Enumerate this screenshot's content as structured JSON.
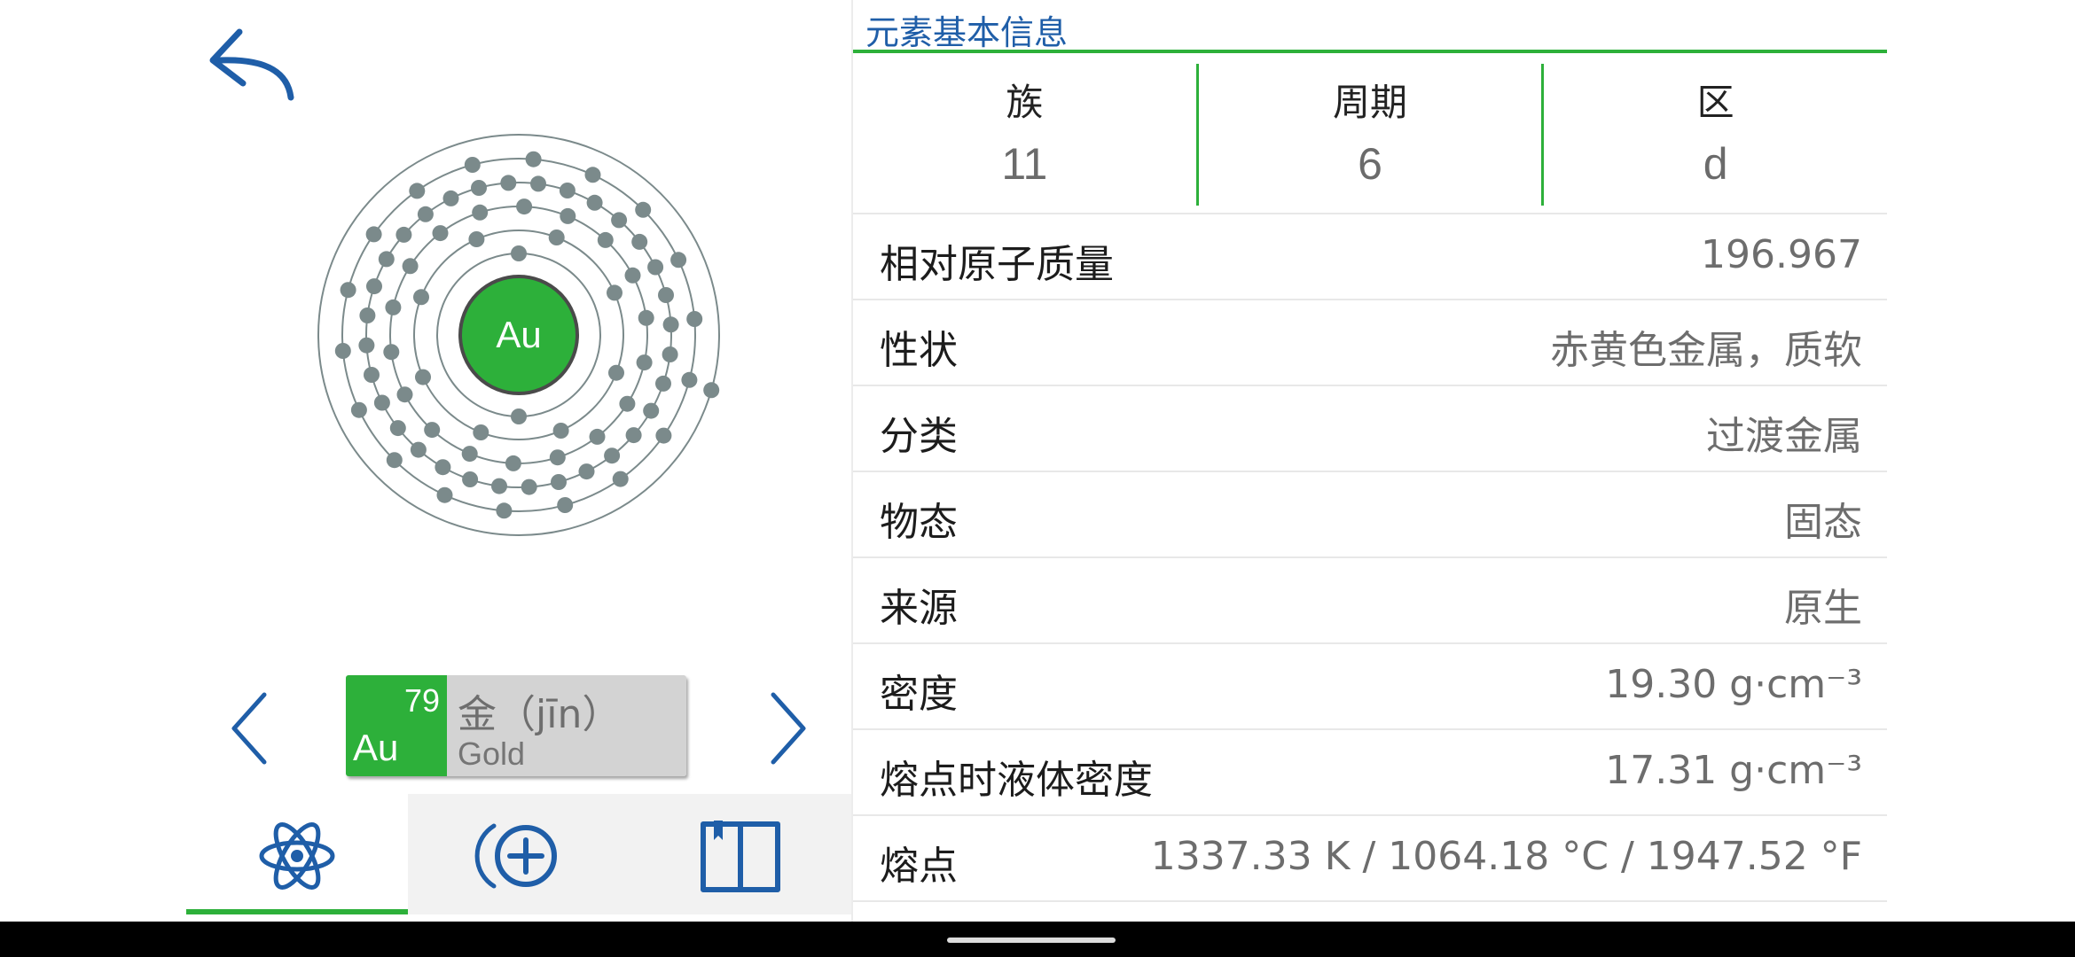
{
  "atom": {
    "symbol": "Au",
    "shell_electrons": [
      2,
      8,
      18,
      32,
      18,
      1
    ],
    "nucleus_color": "#2db03a",
    "electron_color": "#7b8a8b"
  },
  "card": {
    "atomic_number": "79",
    "symbol": "Au",
    "name_zh": "金（jīn）",
    "name_en": "Gold"
  },
  "tabs": [
    {
      "icon": "atom-icon",
      "active": true
    },
    {
      "icon": "add-circle-icon",
      "active": false
    },
    {
      "icon": "book-icon",
      "active": false
    }
  ],
  "info": {
    "section_title": "元素基本信息",
    "summary": [
      {
        "label": "族",
        "value": "11"
      },
      {
        "label": "周期",
        "value": "6"
      },
      {
        "label": "区",
        "value": "d"
      }
    ],
    "properties": [
      {
        "label": "相对原子质量",
        "value": "196.967"
      },
      {
        "label": "性状",
        "value": "赤黄色金属，质软"
      },
      {
        "label": "分类",
        "value": "过渡金属"
      },
      {
        "label": "物态",
        "value": "固态"
      },
      {
        "label": "来源",
        "value": "原生"
      },
      {
        "label": "密度",
        "value": "19.30 g·cm⁻³"
      },
      {
        "label": "熔点时液体密度",
        "value": "17.31 g·cm⁻³"
      },
      {
        "label": "熔点",
        "value": "1337.33 K / 1064.18 °C / 1947.52 °F"
      }
    ]
  },
  "colors": {
    "accent_green": "#2db03a",
    "accent_blue": "#1f5ea8"
  }
}
